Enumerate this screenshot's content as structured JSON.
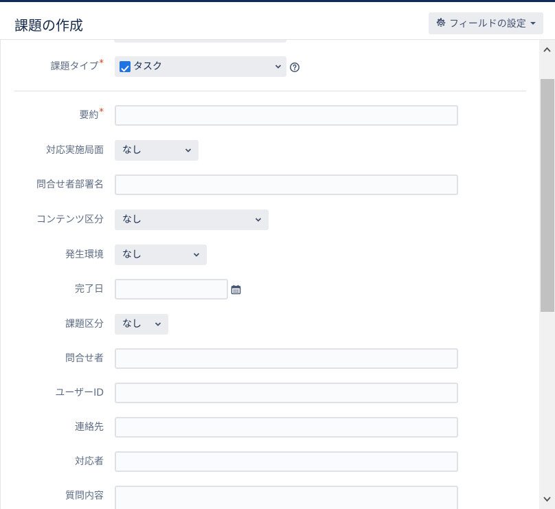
{
  "header": {
    "title": "課題の作成",
    "config_button": "フィールドの設定"
  },
  "issue_type": {
    "label": "課題タイプ",
    "required_mark": "*",
    "value": "タスク"
  },
  "fields": {
    "summary": {
      "label": "要約",
      "required_mark": "*"
    },
    "response_phase": {
      "label": "対応実施局面",
      "value": "なし"
    },
    "inquirer_dept": {
      "label": "問合せ者部署名"
    },
    "content_category": {
      "label": "コンテンツ区分",
      "value": "なし"
    },
    "environment": {
      "label": "発生環境",
      "value": "なし"
    },
    "due_date": {
      "label": "完了日"
    },
    "issue_category": {
      "label": "課題区分",
      "value": "なし"
    },
    "inquirer": {
      "label": "問合せ者"
    },
    "user_id": {
      "label": "ユーザーID"
    },
    "contact": {
      "label": "連絡先"
    },
    "assignee": {
      "label": "対応者"
    },
    "question": {
      "label": "質問内容"
    }
  },
  "colors": {
    "accent": "#1f73e5",
    "required": "#de350b",
    "top_bar": "#0f2a5c"
  }
}
